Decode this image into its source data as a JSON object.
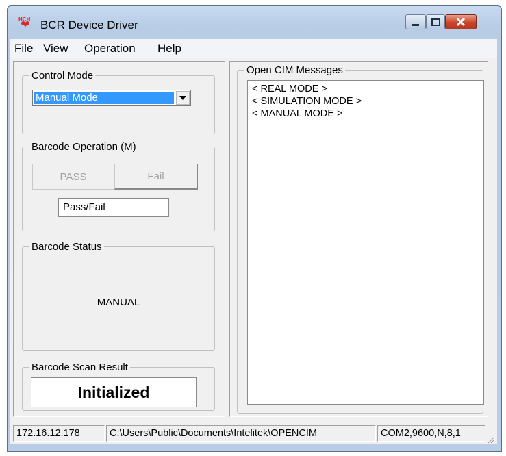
{
  "window": {
    "title": "BCR Device Driver",
    "icon": "hch-app-icon"
  },
  "menu": [
    "File",
    "View",
    "Operation",
    "Help"
  ],
  "control_mode": {
    "label": "Control Mode",
    "selected": "Manual Mode"
  },
  "barcode_operation": {
    "label": "Barcode Operation (M)",
    "pass_label": "PASS",
    "fail_label": "Fail",
    "result_field": "Pass/Fail"
  },
  "barcode_status": {
    "label": "Barcode Status",
    "value": "MANUAL"
  },
  "scan_result": {
    "label": "Barcode Scan Result",
    "value": "Initialized"
  },
  "messages": {
    "label": "Open CIM Messages",
    "items": [
      "< REAL MODE >",
      "< SIMULATION MODE >",
      "< MANUAL MODE >"
    ]
  },
  "statusbar": {
    "ip": "172.16.12.178",
    "path": "C:\\Users\\Public\\Documents\\Intelitek\\OPENCIM",
    "port": "COM2,9600,N,8,1"
  },
  "colors": {
    "selection": "#3399ff",
    "close_button": "#c8442a"
  }
}
